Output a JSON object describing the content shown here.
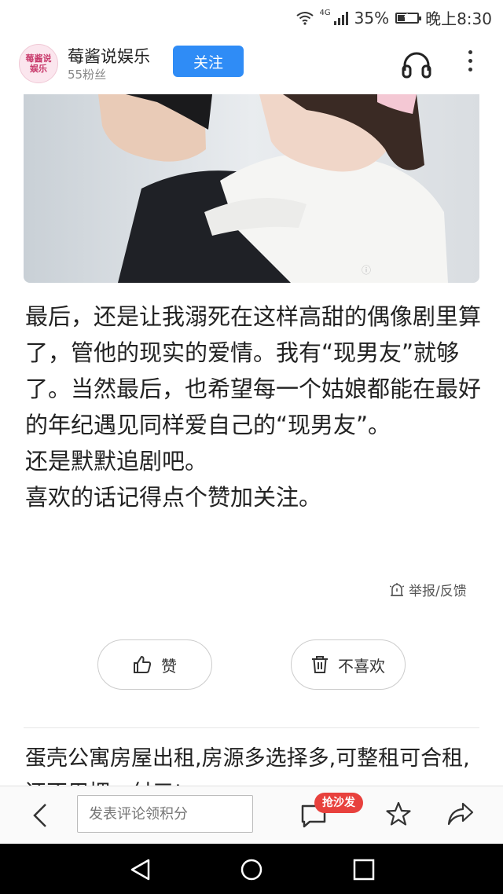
{
  "status_bar": {
    "network": "4G",
    "battery": "35%",
    "time": "晚上8:30"
  },
  "header": {
    "avatar_text": "莓酱说娱乐",
    "author_name": "莓酱说娱乐",
    "fans": "55粉丝",
    "follow_label": "关注",
    "icons": [
      "headphone-icon",
      "more-icon"
    ]
  },
  "article": {
    "paragraphs": [
      "最后，还是让我溺死在这样高甜的偶像剧里算了，管他的现实的爱情。我有“现男友”就够了。当然最后，也希望每一个姑娘都能在最好的年纪遇见同样爱自己的“现男友”。",
      "还是默默追剧吧。",
      "喜欢的话记得点个赞加关注。"
    ]
  },
  "report_label": "举报/反馈",
  "reactions": {
    "like_label": "赞",
    "dislike_label": "不喜欢"
  },
  "ad": {
    "text": "蛋壳公寓房屋出租,房源多选择多,可整租可合租,还不用押一付三!"
  },
  "bottom_bar": {
    "comment_placeholder": "发表评论领积分",
    "sofa_badge": "抢沙发"
  },
  "colors": {
    "accent": "#2f8cf6",
    "badge": "#e8413d"
  }
}
